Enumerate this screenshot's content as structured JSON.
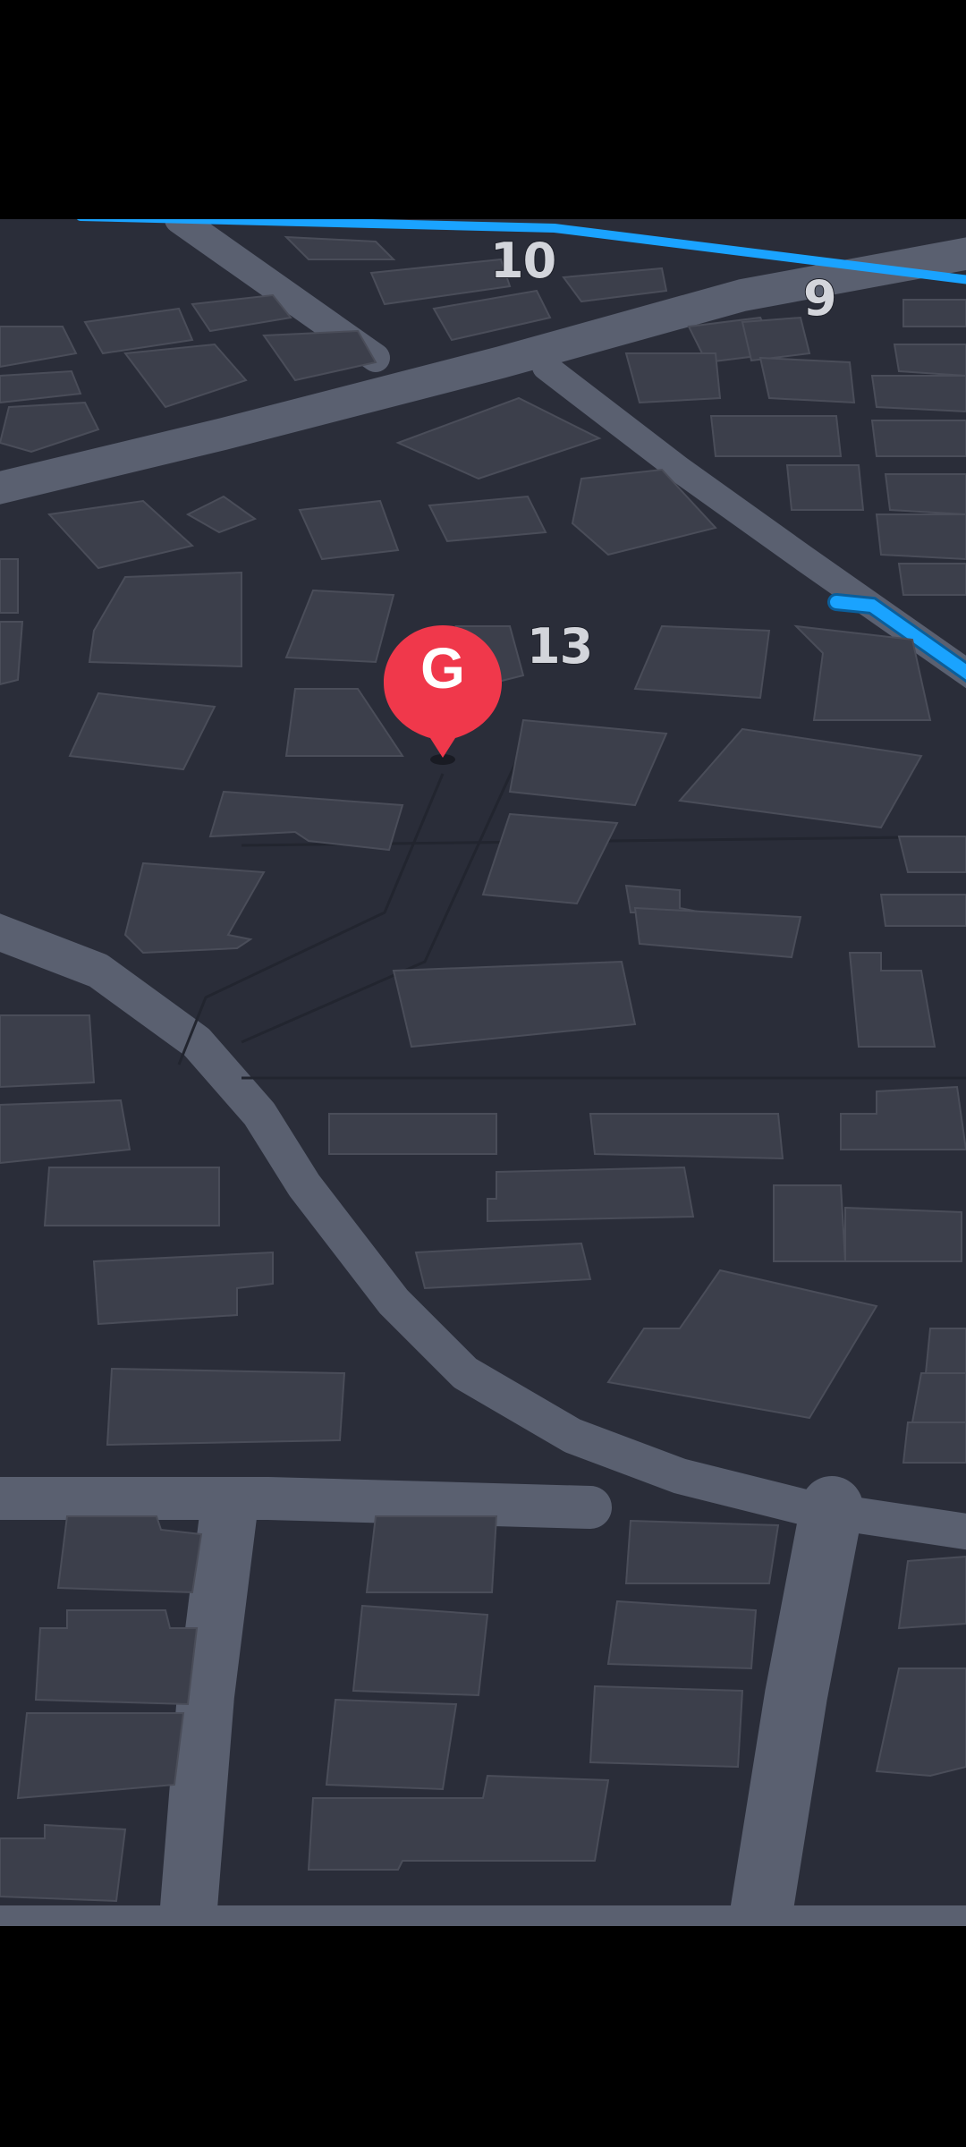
{
  "map": {
    "house_numbers": {
      "n10": "10",
      "n9": "9",
      "n13": "13"
    },
    "destination_pin": {
      "letter": "G",
      "color": "#f0384b"
    },
    "colors": {
      "background": "#2a2d39",
      "road": "#5a6070",
      "building": "#3c3f4b",
      "route": "#1aa3ff"
    }
  }
}
